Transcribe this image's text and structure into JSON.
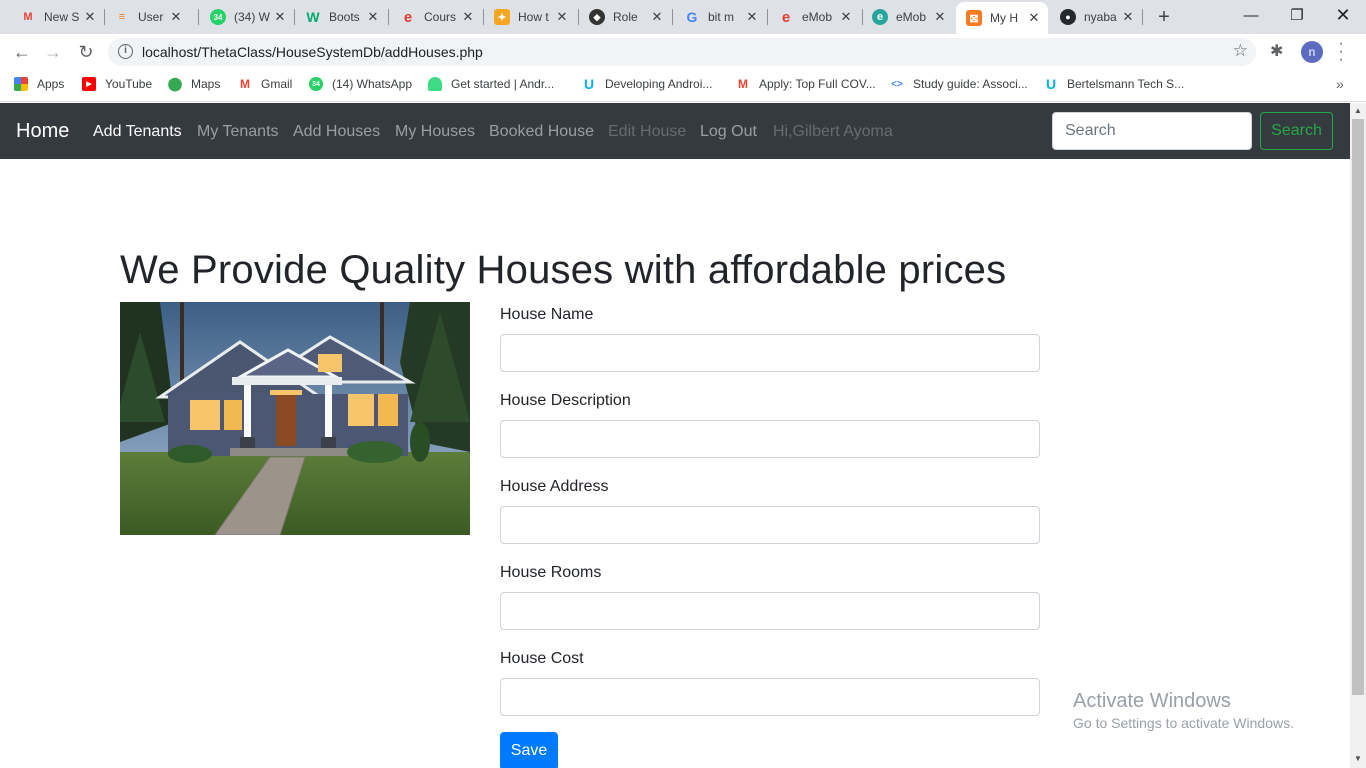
{
  "browser": {
    "tabs": [
      {
        "title": "New S",
        "icon": "gmail-icon",
        "color": "#ea4335",
        "glyph": "M"
      },
      {
        "title": "User",
        "icon": "stackoverflow-icon",
        "color": "#f48024",
        "glyph": "S"
      },
      {
        "title": "(34) W",
        "icon": "whatsapp-icon",
        "color": "#25d366",
        "glyph": "34"
      },
      {
        "title": "Boots",
        "icon": "w3schools-icon",
        "color": "#04aa6d",
        "glyph": "W"
      },
      {
        "title": "Cours",
        "icon": "emobilis-icon",
        "color": "#e53935",
        "glyph": "e"
      },
      {
        "title": "How t",
        "icon": "howto-icon",
        "color": "#f5a623",
        "glyph": "H"
      },
      {
        "title": "Role",
        "icon": "role-site-icon",
        "color": "#333333",
        "glyph": "◆"
      },
      {
        "title": "bit m",
        "icon": "google-icon",
        "color": "#4285f4",
        "glyph": "G"
      },
      {
        "title": "eMob",
        "icon": "emobilis-icon",
        "color": "#e53935",
        "glyph": "e"
      },
      {
        "title": "eMob",
        "icon": "emobilis-globe-icon",
        "color": "#26a69a",
        "glyph": "e"
      },
      {
        "title": "My H",
        "icon": "xampp-icon",
        "color": "#fb7a24",
        "glyph": "X",
        "active": true
      },
      {
        "title": "nyaba",
        "icon": "github-icon",
        "color": "#24292e",
        "glyph": "◉"
      }
    ],
    "url": "localhost/ThetaClass/HouseSystemDb/addHouses.php",
    "profile_initial": "n",
    "bookmarks": [
      {
        "label": "Apps",
        "icon": "apps-grid-icon",
        "color": "#e8453c",
        "glyph": "⋮"
      },
      {
        "label": "YouTube",
        "icon": "youtube-icon",
        "color": "#ff0000",
        "glyph": "▶"
      },
      {
        "label": "Maps",
        "icon": "maps-icon",
        "color": "#34a853",
        "glyph": "●"
      },
      {
        "label": "Gmail",
        "icon": "gmail-icon",
        "color": "#ea4335",
        "glyph": "M"
      },
      {
        "label": "(14) WhatsApp",
        "icon": "whatsapp-icon",
        "color": "#25d366",
        "glyph": "34"
      },
      {
        "label": "Get started | Andr...",
        "icon": "android-icon",
        "color": "#3ddc84",
        "glyph": "A"
      },
      {
        "label": "Developing Androi...",
        "icon": "udacity-icon",
        "color": "#02b3e4",
        "glyph": "U"
      },
      {
        "label": "Apply: Top Full COV...",
        "icon": "gmail-icon",
        "color": "#ea4335",
        "glyph": "M"
      },
      {
        "label": "Study guide: Associ...",
        "icon": "code-icon",
        "color": "#4285f4",
        "glyph": "<>"
      },
      {
        "label": "Bertelsmann Tech S...",
        "icon": "udacity-icon",
        "color": "#02b3e4",
        "glyph": "U"
      }
    ]
  },
  "navbar": {
    "brand": "Home",
    "links": [
      {
        "label": "Add Tenants",
        "state": "active"
      },
      {
        "label": "My Tenants",
        "state": "normal"
      },
      {
        "label": "Add Houses",
        "state": "normal"
      },
      {
        "label": "My Houses",
        "state": "normal"
      },
      {
        "label": "Booked House",
        "state": "normal"
      },
      {
        "label": "Edit House",
        "state": "disabled"
      },
      {
        "label": "Log Out",
        "state": "normal"
      }
    ],
    "greeting": "Hi,Gilbert Ayoma",
    "search_placeholder": "Search",
    "search_button": "Search"
  },
  "main": {
    "headline": "We Provide Quality Houses with affordable prices",
    "form": {
      "fields": [
        {
          "label": "House Name",
          "value": ""
        },
        {
          "label": "House Description",
          "value": ""
        },
        {
          "label": "House Address",
          "value": ""
        },
        {
          "label": "House Rooms",
          "value": ""
        },
        {
          "label": "House Cost",
          "value": ""
        }
      ],
      "submit": "Save"
    }
  },
  "watermark": {
    "title": "Activate Windows",
    "subtitle": "Go to Settings to activate Windows."
  }
}
